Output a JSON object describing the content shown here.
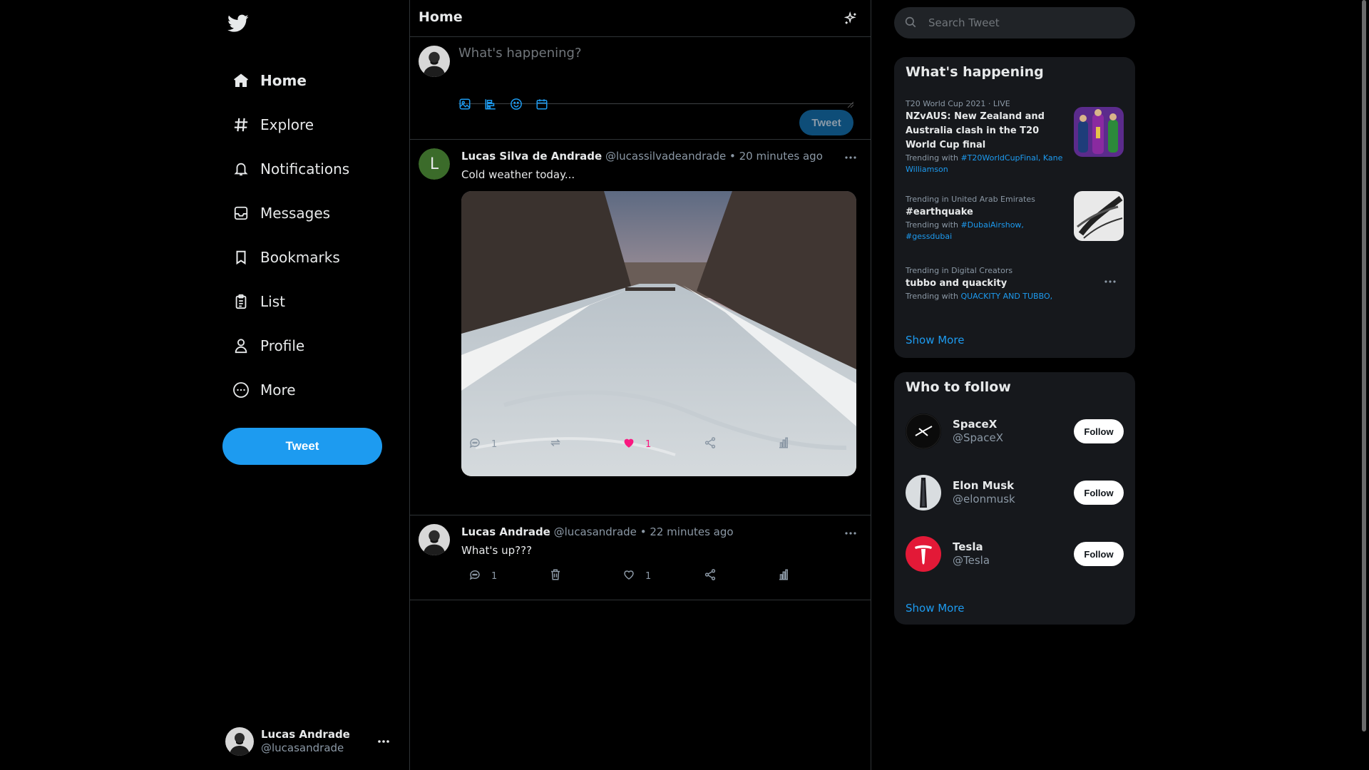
{
  "colors": {
    "accent": "#1d9bf0",
    "like": "#f91880",
    "background": "#000000",
    "panel": "#16181c"
  },
  "sidebar": {
    "logo_icon": "twitter-bird-icon",
    "items": [
      {
        "label": "Home",
        "icon": "home-icon",
        "active": true
      },
      {
        "label": "Explore",
        "icon": "hashtag-icon"
      },
      {
        "label": "Notifications",
        "icon": "bell-icon"
      },
      {
        "label": "Messages",
        "icon": "inbox-icon"
      },
      {
        "label": "Bookmarks",
        "icon": "bookmark-icon"
      },
      {
        "label": "List",
        "icon": "clipboard-list-icon"
      },
      {
        "label": "Profile",
        "icon": "person-icon"
      },
      {
        "label": "More",
        "icon": "more-circle-icon"
      }
    ],
    "tweet_button": "Tweet",
    "account": {
      "name": "Lucas Andrade",
      "handle": "@lucasandrade"
    }
  },
  "main": {
    "title": "Home",
    "composer": {
      "placeholder": "What's happening?",
      "tweet_button": "Tweet"
    },
    "tweets": [
      {
        "author": "Lucas Silva de Andrade",
        "handle": "@lucassilvadeandrade",
        "time": "20 minutes ago",
        "avatar_letter": "L",
        "text": "Cold weather today...",
        "image": "frozen-river-photo",
        "replies": "1",
        "likes": "1",
        "liked": true
      },
      {
        "author": "Lucas Andrade",
        "handle": "@lucasandrade",
        "time": "22 minutes ago",
        "text": "What's up???",
        "replies": "1",
        "likes": "1",
        "liked": false
      }
    ]
  },
  "right": {
    "search_placeholder": "Search Tweet",
    "happening": {
      "title": "What's happening",
      "trends": [
        {
          "context": "T20 World Cup 2021 · LIVE",
          "name": "NZvAUS: New Zealand and Australia clash in the T20 World Cup final",
          "with_prefix": "Trending with ",
          "tags": "#T20WorldCupFinal, Kane Williamson"
        },
        {
          "context": "Trending in United Arab Emirates",
          "name": "#earthquake",
          "with_prefix": "Trending with ",
          "tags": "#DubaiAirshow, #gessdubai"
        },
        {
          "context": "Trending in Digital Creators",
          "name": "tubbo and quackity",
          "with_prefix": "Trending with ",
          "tags": "QUACKITY AND TUBBO,"
        }
      ],
      "show_more": "Show More"
    },
    "follow": {
      "title": "Who to follow",
      "accounts": [
        {
          "name": "SpaceX",
          "handle": "@SpaceX",
          "button": "Follow"
        },
        {
          "name": "Elon Musk",
          "handle": "@elonmusk",
          "button": "Follow"
        },
        {
          "name": "Tesla",
          "handle": "@Tesla",
          "button": "Follow"
        }
      ],
      "show_more": "Show More"
    }
  }
}
